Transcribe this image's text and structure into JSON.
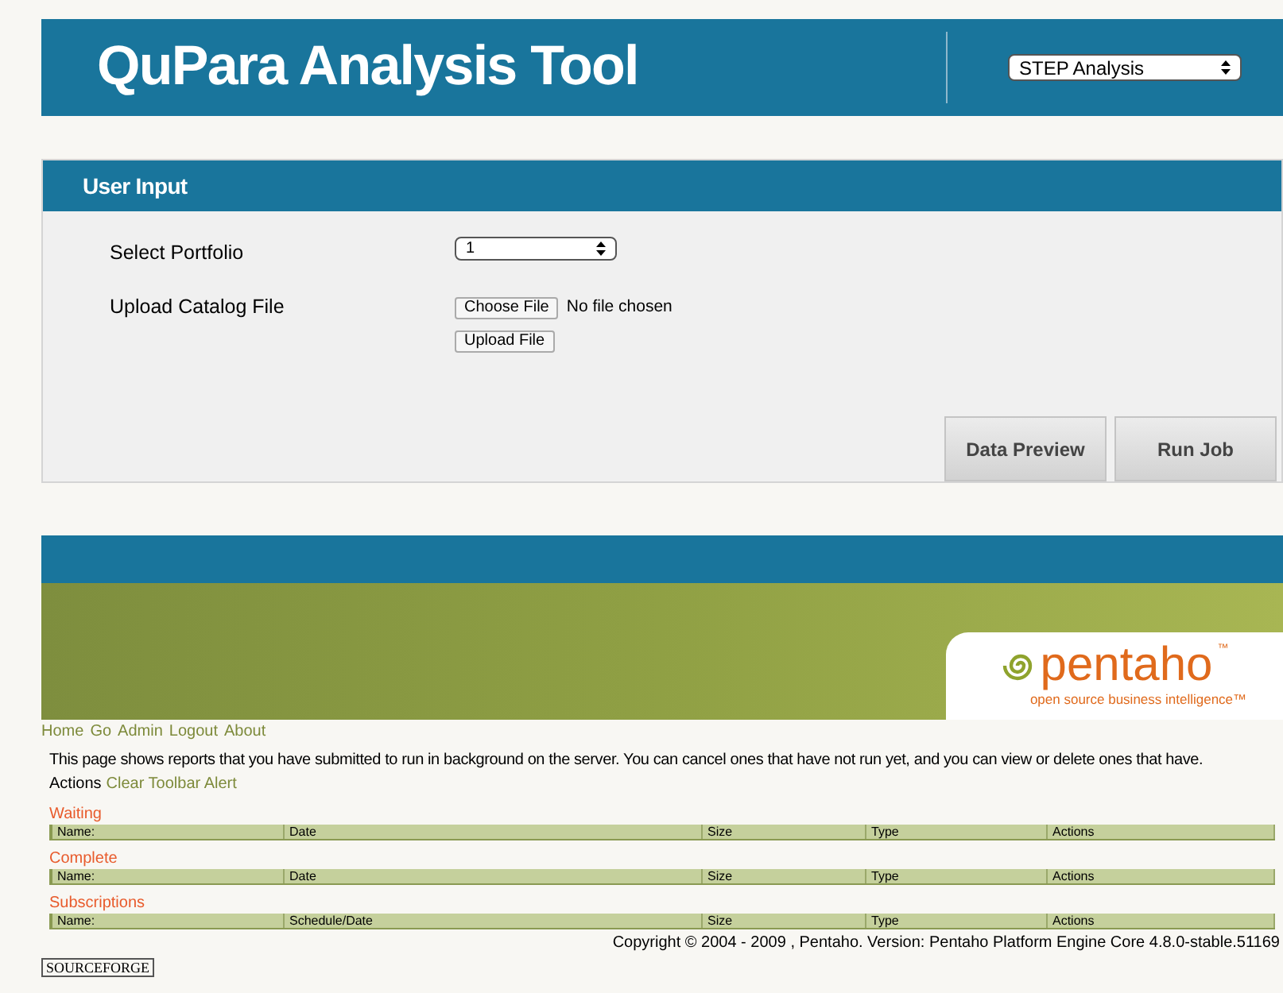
{
  "header": {
    "title": "QuPara Analysis Tool",
    "analysis_select": {
      "value": "STEP Analysis"
    }
  },
  "user_input": {
    "title": "User Input",
    "fields": [
      {
        "kind": "select",
        "label": "Select Portfolio",
        "value": "1"
      },
      {
        "kind": "file",
        "label": "Upload Catalog File",
        "choose_button": "Choose File",
        "file_status": "No file chosen",
        "upload_button": "Upload File"
      }
    ],
    "buttons": [
      "Data Preview",
      "Run Job"
    ]
  },
  "pentaho": {
    "logo": "pentaho",
    "trademark": "™",
    "tagline": "open source business intelligence™",
    "nav": [
      "Home",
      "Go",
      "Admin",
      "Logout",
      "About"
    ],
    "description": "This page shows reports that you have submitted to run in background on the server. You can cancel ones that have not run yet, and you can view or delete ones that have.",
    "actions_label": "Actions",
    "actions_link": "Clear Toolbar Alert",
    "sections": [
      {
        "title": "Waiting",
        "columns": [
          "Name:",
          "Date",
          "Size",
          "Type",
          "Actions"
        ]
      },
      {
        "title": "Complete",
        "columns": [
          "Name:",
          "Date",
          "Size",
          "Type",
          "Actions"
        ]
      },
      {
        "title": "Subscriptions",
        "columns": [
          "Name:",
          "Schedule/Date",
          "Size",
          "Type",
          "Actions"
        ]
      }
    ],
    "copyright": "Copyright © 2004 - 2009 , Pentaho. Version: Pentaho Platform Engine Core 4.8.0-stable.51169"
  },
  "footer_logo": "SOURCEFORGE"
}
